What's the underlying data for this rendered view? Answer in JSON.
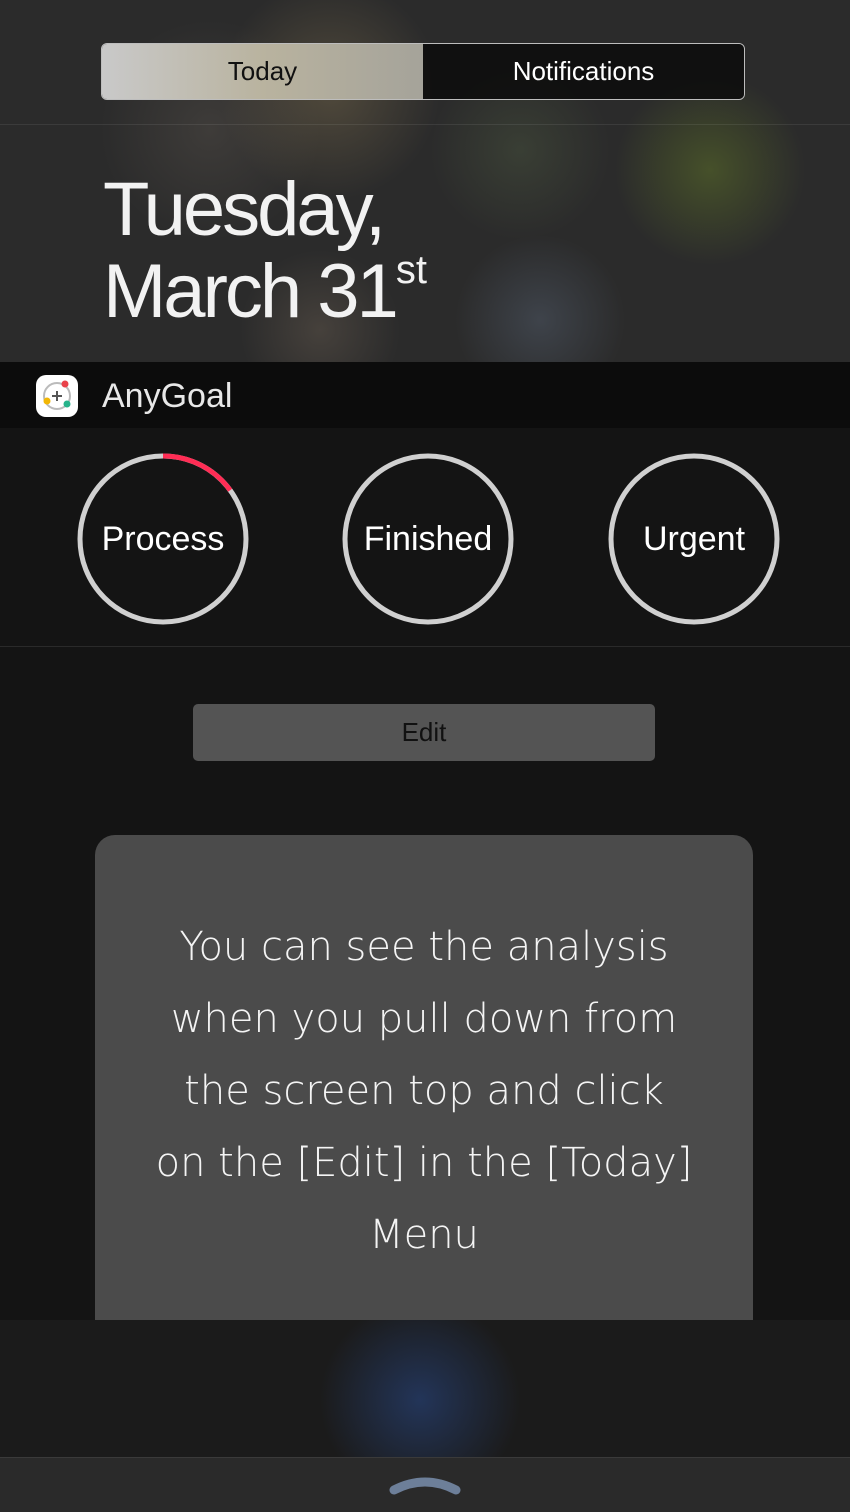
{
  "segmented_control": {
    "tabs": [
      {
        "label": "Today",
        "selected": true
      },
      {
        "label": "Notifications",
        "selected": false
      }
    ]
  },
  "date": {
    "line1": "Tuesday,",
    "line2_main": "March 31",
    "line2_suffix": "st"
  },
  "widget": {
    "app_name": "AnyGoal",
    "app_icon": "anygoal-icon",
    "rings": [
      {
        "label": "Process",
        "progress": 0.15,
        "progress_color": "#ff2d55",
        "track_color": "#d0d0d0"
      },
      {
        "label": "Finished",
        "progress": 0,
        "progress_color": "#ff2d55",
        "track_color": "#d0d0d0"
      },
      {
        "label": "Urgent",
        "progress": 0,
        "progress_color": "#ff2d55",
        "track_color": "#d0d0d0"
      }
    ],
    "edit_label": "Edit"
  },
  "tooltip": {
    "lines": [
      "You can see the analysis",
      "when you pull down from",
      "the screen top and click",
      "on the [Edit] in the [Today]",
      "Menu"
    ]
  },
  "bottom": {
    "handle_icon": "chevron-up-icon"
  }
}
